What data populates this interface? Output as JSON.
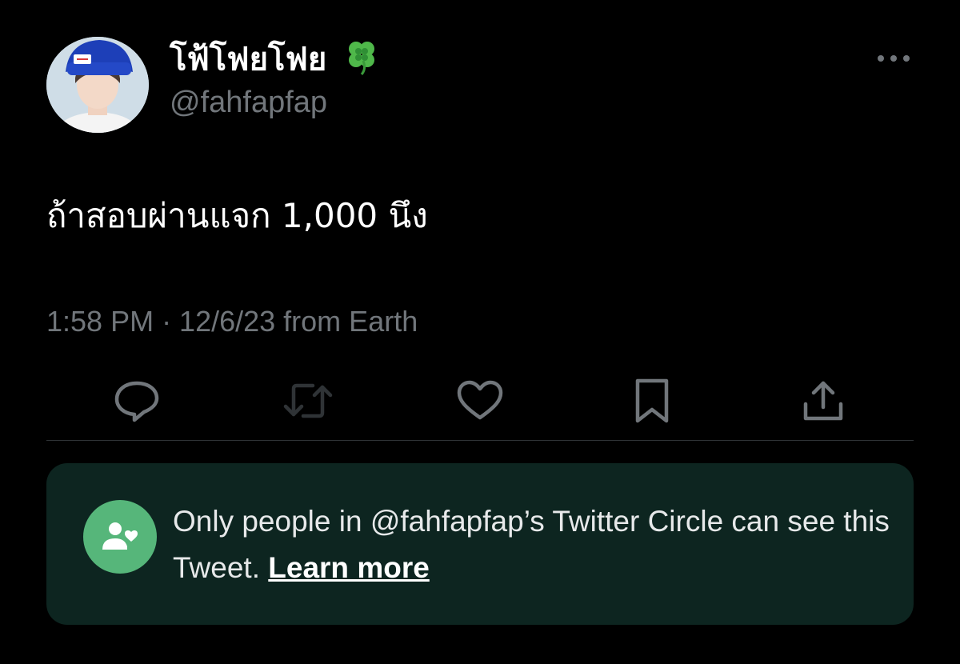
{
  "author": {
    "display_name": "โฟ้โฟยโฟย",
    "emoji_icon": "four-leaf-clover",
    "handle": "@fahfapfap"
  },
  "tweet": {
    "text": "ถ้าสอบผ่านแจก 1,000 นึง",
    "meta": "1:58 PM · 12/6/23 from Earth"
  },
  "actions": [
    {
      "name": "reply",
      "icon": "speech-bubble"
    },
    {
      "name": "retweet",
      "icon": "retweet-arrows"
    },
    {
      "name": "like",
      "icon": "heart"
    },
    {
      "name": "bookmark",
      "icon": "bookmark"
    },
    {
      "name": "share",
      "icon": "upload-arrow"
    }
  ],
  "circle_notice": {
    "text": "Only people in @fahfapfap’s Twitter Circle can see this Tweet. ",
    "link": "Learn more",
    "icon": "circle-people-heart",
    "accent": "#56b67a",
    "background": "#0d2520"
  },
  "colors": {
    "background": "#000000",
    "secondary_text": "#71767b",
    "icon": "#71767b"
  }
}
